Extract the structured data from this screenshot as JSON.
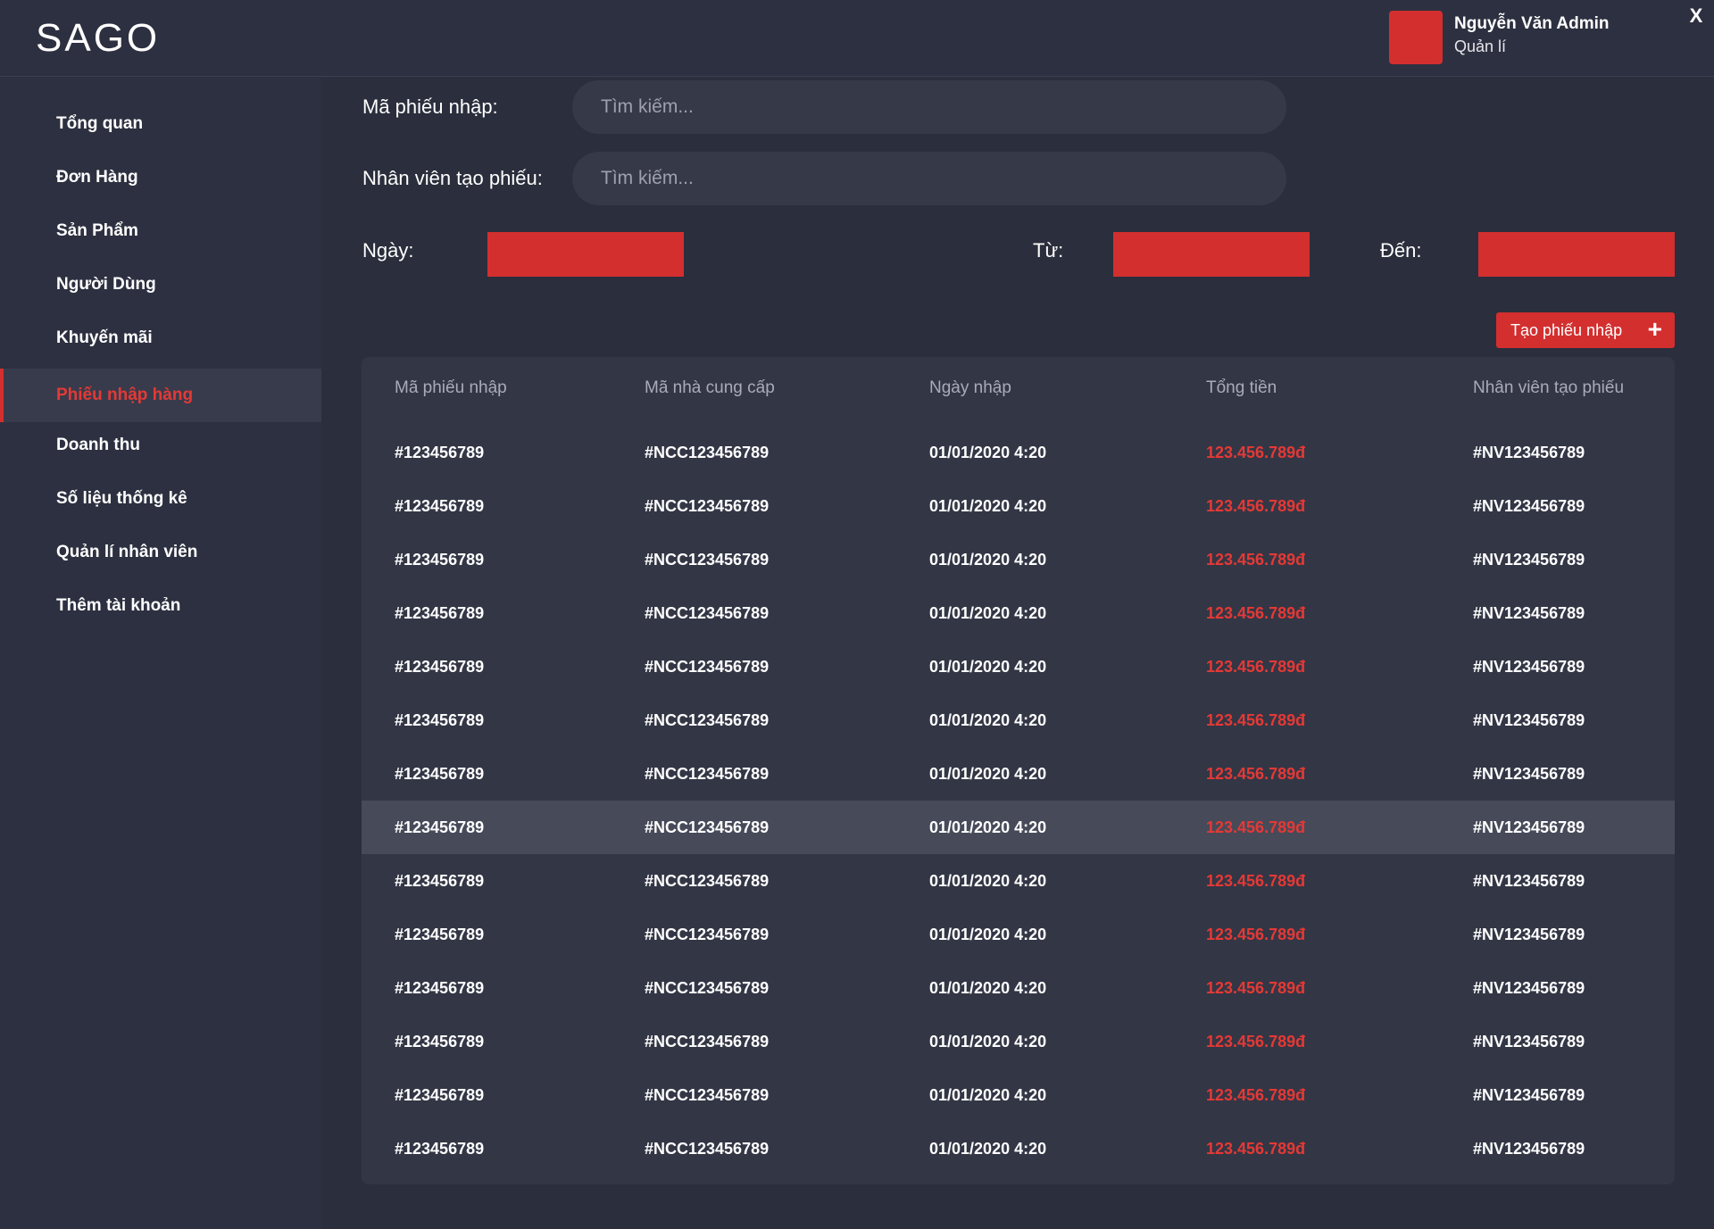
{
  "app": {
    "logo": "SAGO"
  },
  "user": {
    "name": "Nguyễn Văn Admin",
    "role": "Quản lí",
    "close_label": "X"
  },
  "sidebar": {
    "items": [
      {
        "label": "Tổng quan"
      },
      {
        "label": "Đơn Hàng"
      },
      {
        "label": "Sản Phẩm"
      },
      {
        "label": "Người Dùng"
      },
      {
        "label": "Khuyến mãi"
      },
      {
        "label": "Phiếu nhập hàng",
        "active": true
      },
      {
        "label": "Doanh thu"
      },
      {
        "label": "Số liệu thống kê"
      },
      {
        "label": "Quản lí nhân viên"
      },
      {
        "label": "Thêm tài khoản"
      }
    ]
  },
  "filters": {
    "code_label": "Mã phiếu nhập:",
    "code_placeholder": "Tìm kiếm...",
    "staff_label": "Nhân viên tạo phiếu:",
    "staff_placeholder": "Tìm kiếm...",
    "date_label": "Ngày:",
    "from_label": "Từ:",
    "to_label": "Đến:"
  },
  "actions": {
    "create_label": "Tạo phiếu nhập",
    "create_icon": "plus-icon"
  },
  "colors": {
    "accent": "#d32f2f",
    "money": "#e53935",
    "background": "#2d3040"
  },
  "table": {
    "headers": [
      "Mã phiếu nhập",
      "Mã nhà cung cấp",
      "Ngày nhập",
      "Tổng tiền",
      "Nhân viên tạo phiếu"
    ],
    "selected_row": 7,
    "rows": [
      [
        "#123456789",
        "#NCC123456789",
        "01/01/2020 4:20",
        "123.456.789đ",
        "#NV123456789"
      ],
      [
        "#123456789",
        "#NCC123456789",
        "01/01/2020 4:20",
        "123.456.789đ",
        "#NV123456789"
      ],
      [
        "#123456789",
        "#NCC123456789",
        "01/01/2020 4:20",
        "123.456.789đ",
        "#NV123456789"
      ],
      [
        "#123456789",
        "#NCC123456789",
        "01/01/2020 4:20",
        "123.456.789đ",
        "#NV123456789"
      ],
      [
        "#123456789",
        "#NCC123456789",
        "01/01/2020 4:20",
        "123.456.789đ",
        "#NV123456789"
      ],
      [
        "#123456789",
        "#NCC123456789",
        "01/01/2020 4:20",
        "123.456.789đ",
        "#NV123456789"
      ],
      [
        "#123456789",
        "#NCC123456789",
        "01/01/2020 4:20",
        "123.456.789đ",
        "#NV123456789"
      ],
      [
        "#123456789",
        "#NCC123456789",
        "01/01/2020 4:20",
        "123.456.789đ",
        "#NV123456789"
      ],
      [
        "#123456789",
        "#NCC123456789",
        "01/01/2020 4:20",
        "123.456.789đ",
        "#NV123456789"
      ],
      [
        "#123456789",
        "#NCC123456789",
        "01/01/2020 4:20",
        "123.456.789đ",
        "#NV123456789"
      ],
      [
        "#123456789",
        "#NCC123456789",
        "01/01/2020 4:20",
        "123.456.789đ",
        "#NV123456789"
      ],
      [
        "#123456789",
        "#NCC123456789",
        "01/01/2020 4:20",
        "123.456.789đ",
        "#NV123456789"
      ],
      [
        "#123456789",
        "#NCC123456789",
        "01/01/2020 4:20",
        "123.456.789đ",
        "#NV123456789"
      ],
      [
        "#123456789",
        "#NCC123456789",
        "01/01/2020 4:20",
        "123.456.789đ",
        "#NV123456789"
      ]
    ]
  }
}
